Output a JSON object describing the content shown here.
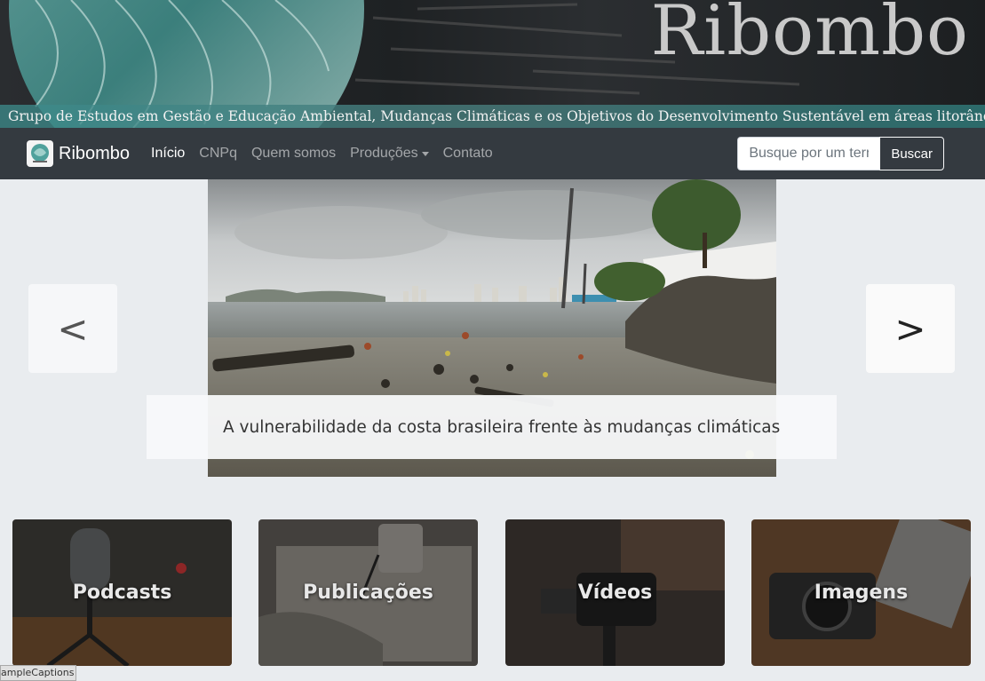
{
  "banner": {
    "title": "Ribombo",
    "subtitle": "Grupo de Estudos em Gestão e Educação Ambiental, Mudanças Climáticas e os Objetivos do Desenvolvimento Sustentável em áreas litorâneas."
  },
  "navbar": {
    "brand": "Ribombo",
    "links": [
      {
        "label": "Início",
        "active": true
      },
      {
        "label": "CNPq"
      },
      {
        "label": "Quem somos"
      },
      {
        "label": "Produções",
        "dropdown": true
      },
      {
        "label": "Contato"
      }
    ],
    "search": {
      "placeholder": "Busque por um termo",
      "button": "Buscar"
    }
  },
  "carousel": {
    "prev": "<",
    "next": ">",
    "caption": "A vulnerabilidade da costa brasileira frente às mudanças climáticas"
  },
  "cards": [
    {
      "label": "Podcasts"
    },
    {
      "label": "Publicações"
    },
    {
      "label": "Vídeos"
    },
    {
      "label": "Imagens"
    }
  ],
  "status": {
    "text": "ampleCaptions"
  },
  "colors": {
    "navbar": "#343a40",
    "page_bg": "#e9ecef",
    "banner_teal": "#3c8c8c"
  }
}
